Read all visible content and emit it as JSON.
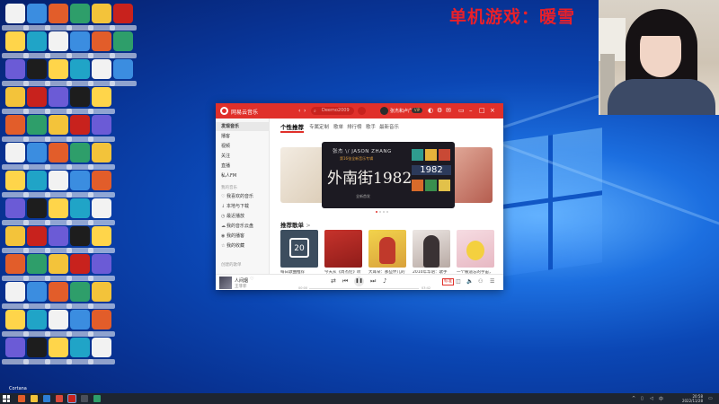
{
  "overlay": {
    "text": "单机游戏：暖雪"
  },
  "music": {
    "app_name": "网易云音乐",
    "search_placeholder": "Deemo2009",
    "user_name": "张杰和卢广仲",
    "vip_badge": "VIP",
    "sidebar": {
      "items": [
        {
          "label": "发现音乐",
          "active": true
        },
        {
          "label": "播客"
        },
        {
          "label": "视频"
        },
        {
          "label": "关注"
        },
        {
          "label": "直播"
        },
        {
          "label": "私人FM"
        }
      ],
      "section_head": "我的音乐",
      "my_items": [
        {
          "icon": "♡",
          "label": "我喜欢的音乐"
        },
        {
          "icon": "↓",
          "label": "本地与下载"
        },
        {
          "icon": "◷",
          "label": "最近播放"
        },
        {
          "icon": "☁",
          "label": "我的音乐云盘"
        },
        {
          "icon": "◉",
          "label": "我的播客"
        },
        {
          "icon": "☆",
          "label": "我的收藏"
        }
      ],
      "created_head": "创建的歌单"
    },
    "tabs": [
      "个性推荐",
      "专属定制",
      "歌单",
      "排行榜",
      "歌手",
      "最新音乐"
    ],
    "banner": {
      "top": "张杰 \\/ JASON ZHANG",
      "subtitle": "第16张全新音乐专辑",
      "title": "外南街1982",
      "tag": "全新首发",
      "tile_label": "1982"
    },
    "recommended_title": "推荐歌单",
    "recommended_arrow": ">",
    "playlists": [
      {
        "cover_text": "20",
        "desc": "每日歌曲推荐"
      },
      {
        "cover_text": "",
        "desc": "今天从《周杰伦》听起|私人雷达"
      },
      {
        "cover_text": "",
        "desc": "大耳朵：那些伴儿的无忧童年"
      },
      {
        "cover_text": "",
        "desc": "2010年华语：歌手们的真心话"
      },
      {
        "cover_text": "",
        "desc": "一个被遗忘的宇宙，让心情好起来"
      }
    ],
    "player": {
      "song": "人间烟",
      "artist": "王菲菲",
      "quality": "标准",
      "time_current": "00:00",
      "time_total": "03:42",
      "progress": 0.0
    }
  },
  "taskbar": {
    "cortana": "Cortana",
    "time": "20:58",
    "date": "2022/11/28"
  },
  "colors": {
    "accent": "#e0302a",
    "overlay_text": "#e8202a",
    "taskbar": "#1e2530"
  }
}
